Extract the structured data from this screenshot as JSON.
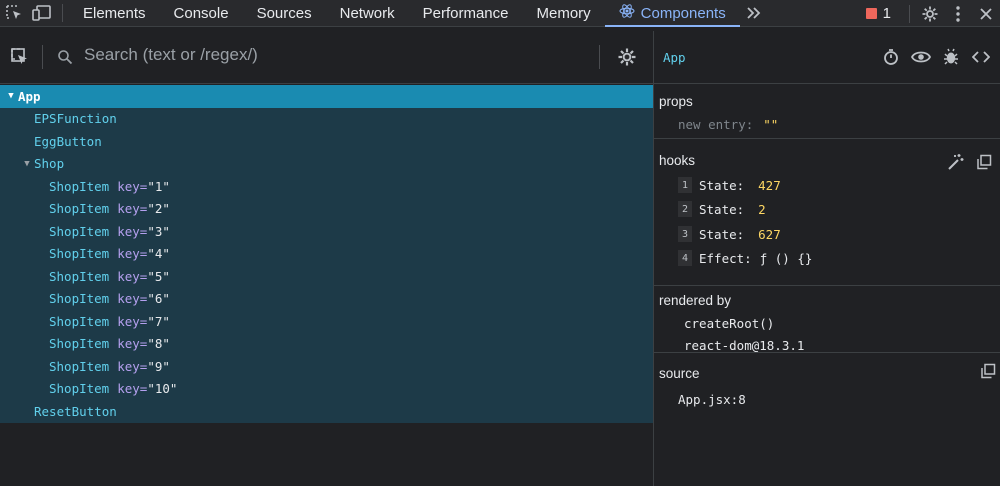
{
  "tabs": [
    {
      "label": "Elements"
    },
    {
      "label": "Console"
    },
    {
      "label": "Sources"
    },
    {
      "label": "Network"
    },
    {
      "label": "Performance"
    },
    {
      "label": "Memory"
    },
    {
      "label": "Components",
      "active": true
    }
  ],
  "issues": {
    "count": "1"
  },
  "search": {
    "placeholder": "Search (text or /regex/)"
  },
  "tree": [
    {
      "name": "App",
      "depth": 0,
      "expanded": true,
      "selected": true
    },
    {
      "name": "EPSFunction",
      "depth": 1
    },
    {
      "name": "EggButton",
      "depth": 1
    },
    {
      "name": "Shop",
      "depth": 1,
      "expanded": true
    },
    {
      "name": "ShopItem",
      "depth": 2,
      "key": "\"1\""
    },
    {
      "name": "ShopItem",
      "depth": 2,
      "key": "\"2\""
    },
    {
      "name": "ShopItem",
      "depth": 2,
      "key": "\"3\""
    },
    {
      "name": "ShopItem",
      "depth": 2,
      "key": "\"4\""
    },
    {
      "name": "ShopItem",
      "depth": 2,
      "key": "\"5\""
    },
    {
      "name": "ShopItem",
      "depth": 2,
      "key": "\"6\""
    },
    {
      "name": "ShopItem",
      "depth": 2,
      "key": "\"7\""
    },
    {
      "name": "ShopItem",
      "depth": 2,
      "key": "\"8\""
    },
    {
      "name": "ShopItem",
      "depth": 2,
      "key": "\"9\""
    },
    {
      "name": "ShopItem",
      "depth": 2,
      "key": "\"10\""
    },
    {
      "name": "ResetButton",
      "depth": 1
    }
  ],
  "key_label": "key=",
  "inspector": {
    "title": "App",
    "props": {
      "title": "props",
      "new_entry": "new entry:",
      "new_entry_value": "\"\""
    },
    "hooks": {
      "title": "hooks",
      "items": [
        {
          "index": "1",
          "label": "State:",
          "value": "427"
        },
        {
          "index": "2",
          "label": "State:",
          "value": "2"
        },
        {
          "index": "3",
          "label": "State:",
          "value": "627"
        },
        {
          "index": "4",
          "label": "Effect:",
          "value": "ƒ () {}"
        }
      ]
    },
    "rendered_by": {
      "title": "rendered by",
      "items": [
        "createRoot()",
        "react-dom@18.3.1"
      ]
    },
    "source": {
      "title": "source",
      "file": "App.jsx:8"
    }
  },
  "colors": {
    "accent": "#8ab4f8",
    "component_name": "#61d0ec",
    "selected_row": "#1a8bb1",
    "tree_bg": "#1d3a48",
    "hook_value": "#fdd663"
  }
}
